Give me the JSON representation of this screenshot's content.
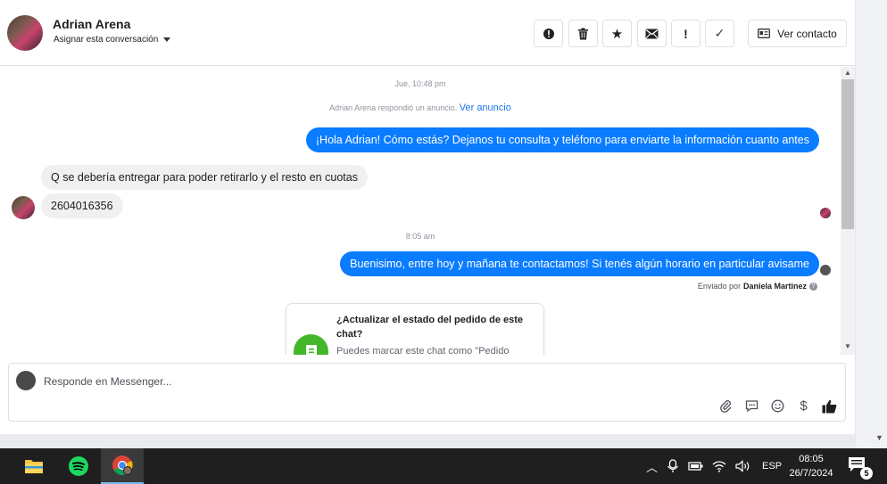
{
  "header": {
    "contact_name": "Adrian Arena",
    "assign_label": "Asignar esta conversación",
    "tools": [
      {
        "icon": "alert-icon",
        "glyph": "!"
      },
      {
        "icon": "trash-icon",
        "glyph": ""
      },
      {
        "icon": "star-icon",
        "glyph": "★"
      },
      {
        "icon": "envelope-icon",
        "glyph": "✉"
      },
      {
        "icon": "exclamation-icon",
        "glyph": "!"
      },
      {
        "icon": "checkmark-icon",
        "glyph": "✓"
      }
    ],
    "view_contact_label": "Ver contacto"
  },
  "conversation": {
    "timestamp_1": "Jue, 10:48 pm",
    "ad_notice": "Adrian Arena respondió un anuncio.",
    "ad_link": "Ver anuncio",
    "messages": [
      {
        "from": "page",
        "text": "¡Hola Adrian! Cómo estás? Dejanos tu consulta y teléfono para enviarte la información cuanto antes"
      },
      {
        "from": "user",
        "text": "Q se debería entregar para poder retirarlo y el resto en cuotas"
      },
      {
        "from": "user",
        "text": "2604016356"
      },
      {
        "from": "page",
        "text": "Buenisimo, entre hoy y mañana te contactamos! Si tenés algún horario en particular avisame"
      }
    ],
    "timestamp_2": "8:05 am",
    "sent_by_prefix": "Enviado por",
    "sent_by_name": "Daniela Martinez",
    "card": {
      "title": "¿Actualizar el estado del pedido de este chat?",
      "description": "Puedes marcar este chat como \"Pedido"
    }
  },
  "composer": {
    "placeholder": "Responde en Messenger...",
    "actions": [
      "paperclip-icon",
      "saved-reply-icon",
      "emoji-icon",
      "dollar-icon",
      "thumbs-up-icon"
    ]
  },
  "taskbar": {
    "apps": [
      "file-explorer-icon",
      "spotify-icon",
      "chrome-icon"
    ],
    "language": "ESP",
    "time": "08:05",
    "date": "26/7/2024",
    "notification_count": "5"
  },
  "colors": {
    "accent": "#0a7cff",
    "incoming_bubble": "#f0f0f0",
    "card_icon": "#42b72a",
    "taskbar": "#1f1f1f"
  }
}
